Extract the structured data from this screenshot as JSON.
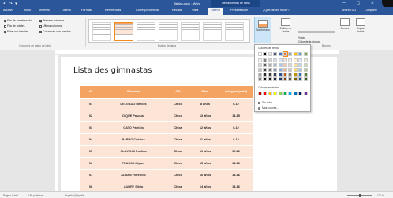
{
  "window": {
    "title": "Tablas.docx - Word",
    "table_tools": "Herramientas de tabla",
    "quick_access": "↶ ↷ ▾",
    "win_buttons": "— ▢ ✕"
  },
  "tabs": [
    {
      "label": "Archivo"
    },
    {
      "label": "Inicio"
    },
    {
      "label": "Insertar"
    },
    {
      "label": "Diseño"
    },
    {
      "label": "Formato"
    },
    {
      "label": "Referencias"
    },
    {
      "label": "Correspondencia"
    },
    {
      "label": "Revisar"
    },
    {
      "label": "Vista"
    },
    {
      "label": "Diseño"
    },
    {
      "label": "Presentación"
    }
  ],
  "help": "¿Qué desea hacer?",
  "user": "Andrea GG",
  "share": "Compartir",
  "ribbon": {
    "options": [
      {
        "label": "Fila de encabezado"
      },
      {
        "label": "Fila de totales"
      },
      {
        "label": "Filas con bandas"
      },
      {
        "label": "Primera columna"
      },
      {
        "label": "Última columna"
      },
      {
        "label": "Columnas con bandas"
      }
    ],
    "options_group": "Opciones de estilo de tabla",
    "styles_group": "Estilos de tabla",
    "sombreado": "Sombreado",
    "estilos_bordes": "Estilos de borde",
    "grosor": "½ pto",
    "color_pluma": "Color de la pluma",
    "bordes": "Bordes",
    "copiar_borde": "Copiar borde",
    "bordes_group": "Bordes"
  },
  "document": {
    "title": "Lista des gimnastas",
    "headers": [
      "Nº",
      "Gimnasta",
      "G.F",
      "Edad",
      "Categoría (edad)"
    ],
    "rows": [
      [
        "01",
        "DELGADO Marcos",
        "Chico",
        "8 años",
        "6-12"
      ],
      [
        "02",
        "DIQUE Pascual",
        "Chico",
        "13 años",
        "13-15"
      ],
      [
        "03",
        "GATO Patricia",
        "Chica",
        "12 años",
        "6-12"
      ],
      [
        "04",
        "BARBO Cristina",
        "Chica",
        "11 años",
        "6-12"
      ],
      [
        "05",
        "CLAVELÍA Paulina",
        "Chica",
        "19 años",
        "17-20"
      ],
      [
        "06",
        "FRASCA Miguel",
        "Chico",
        "15 años",
        "13-16"
      ],
      [
        "07",
        "ALBAN Florencio",
        "Chico",
        "16 años",
        "13-16"
      ],
      [
        "08",
        "AUBRY Silvia",
        "Chica",
        "14 años",
        "13-16"
      ]
    ]
  },
  "dropdown": {
    "theme_label": "Colores del tema",
    "standard_label": "Colores estándar",
    "no_color": "Sin color",
    "more_colors": "Más colores...",
    "theme_top": [
      "#ffffff",
      "#000000",
      "#e7e6e6",
      "#44546a",
      "#4472c4",
      "#ed7d31",
      "#a5a5a5",
      "#ffc000",
      "#5b9bd5",
      "#70ad47"
    ],
    "theme_shades": [
      [
        "#f2f2f2",
        "#7f7f7f",
        "#d0cece",
        "#d6dce4",
        "#d9e2f3",
        "#fbe5d5",
        "#ededed",
        "#fff2cc",
        "#deebf6",
        "#e2efd9"
      ],
      [
        "#d8d8d8",
        "#595959",
        "#aeabab",
        "#adb9ca",
        "#b4c6e7",
        "#f7cbac",
        "#dbdbdb",
        "#fee599",
        "#bdd7ee",
        "#c5e0b3"
      ],
      [
        "#bfbfbf",
        "#3f3f3f",
        "#757070",
        "#8496b0",
        "#8eaadb",
        "#f4b183",
        "#c9c9c9",
        "#ffd965",
        "#9cc3e5",
        "#a8d08d"
      ],
      [
        "#a5a5a5",
        "#262626",
        "#3a3838",
        "#323f4f",
        "#2f5496",
        "#c55a11",
        "#7b7b7b",
        "#bf9000",
        "#2e75b5",
        "#538135"
      ],
      [
        "#7f7f7f",
        "#0c0c0c",
        "#171616",
        "#222a35",
        "#1f3864",
        "#833c0b",
        "#525252",
        "#7f6000",
        "#1e4e79",
        "#375623"
      ]
    ],
    "standard": [
      "#c00000",
      "#ff0000",
      "#ffc000",
      "#ffff00",
      "#92d050",
      "#00b050",
      "#00b0f0",
      "#0070c0",
      "#002060",
      "#7030a0"
    ]
  },
  "statusbar": {
    "page": "Página 1 de 1",
    "words": "159 palabras",
    "language": "Español (España)",
    "zoom": "100 %"
  }
}
